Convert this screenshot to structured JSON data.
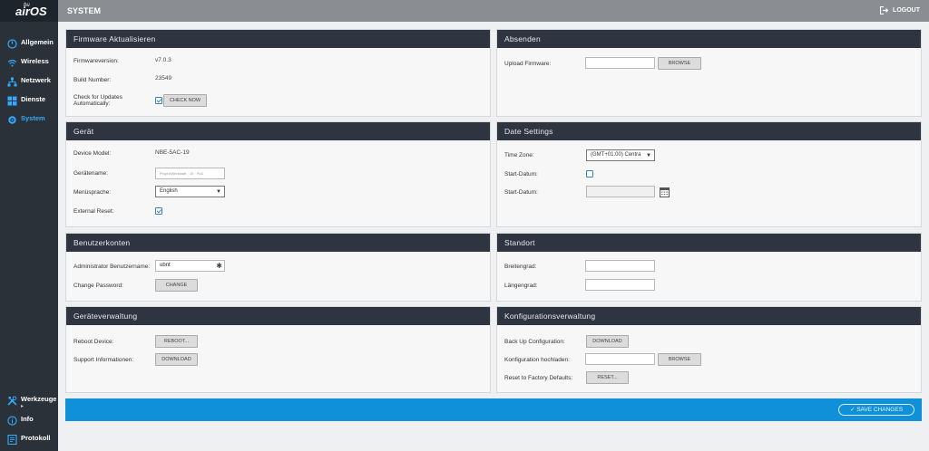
{
  "app": {
    "logo_small": "bu",
    "logo": "airOS"
  },
  "header": {
    "title": "SYSTEM",
    "logout": "LOGOUT"
  },
  "sidebar": {
    "items": [
      {
        "label": "Allgemein",
        "icon": "dashboard-icon"
      },
      {
        "label": "Wireless",
        "icon": "wifi-icon"
      },
      {
        "label": "Netzwerk",
        "icon": "network-icon"
      },
      {
        "label": "Dienste",
        "icon": "services-icon"
      },
      {
        "label": "System",
        "icon": "gear-icon",
        "active": true
      }
    ],
    "bottom": [
      {
        "label": "Werkzeuge",
        "icon": "tools-icon",
        "sub": "▸"
      },
      {
        "label": "Info",
        "icon": "info-icon"
      },
      {
        "label": "Protokoll",
        "icon": "log-icon"
      }
    ]
  },
  "firmware": {
    "title": "Firmware Aktualisieren",
    "version_label": "Firmwareversion:",
    "version": "v7.0.3",
    "build_label": "Build Number:",
    "build": "23549",
    "check_label_1": "Check for Updates",
    "check_label_2": "Automatically:",
    "check_checked": true,
    "check_now": "CHECK NOW"
  },
  "absenden": {
    "title": "Absenden",
    "upload_label": "Upload Firmware:",
    "upload_value": "",
    "browse": "BROWSE"
  },
  "geraet": {
    "title": "Gerät",
    "model_label": "Device Model:",
    "model": "NBE-5AC-19",
    "name_label": "Gerätename:",
    "name_value": "ProjectWerkstatt · 19 · Fuß",
    "lang_label": "Menüsprache:",
    "lang_value": "English",
    "ext_reset_label": "External Reset:",
    "ext_reset_checked": true
  },
  "date": {
    "title": "Date Settings",
    "tz_label": "Time Zone:",
    "tz_value": "(GMT+01:00) Centra",
    "start_date_label": "Start-Datum:",
    "start_date_checked": false,
    "start_date2_label": "Start-Datum:",
    "start_date_value": ""
  },
  "benutzer": {
    "title": "Benutzerkonten",
    "admin_label": "Administrator Benutzername:",
    "admin_value": "ubnt",
    "pw_label": "Change Password:",
    "pw_button": "CHANGE"
  },
  "standort": {
    "title": "Standort",
    "lat_label": "Breitengrad:",
    "lat_value": "",
    "lon_label": "Längengrad:",
    "lon_value": ""
  },
  "geraeteverwaltung": {
    "title": "Geräteverwaltung",
    "reboot_label": "Reboot Device:",
    "reboot_button": "REBOOT...",
    "support_label": "Support Informationen:",
    "support_button": "DOWNLOAD"
  },
  "konfig": {
    "title": "Konfigurationsverwaltung",
    "backup_label": "Back Up Configuration:",
    "backup_button": "DOWNLOAD",
    "upload_label": "Konfiguration hochladen:",
    "upload_value": "",
    "browse": "BROWSE",
    "reset_label": "Reset to Factory Defaults:",
    "reset_button": "RESET..."
  },
  "save": {
    "label": "SAVE CHANGES"
  },
  "colors": {
    "accent": "#1090d8",
    "sidebar": "#2b3139",
    "panel_header": "#2e3440",
    "topbar": "#8a8d91",
    "active_nav": "#33aaff"
  }
}
